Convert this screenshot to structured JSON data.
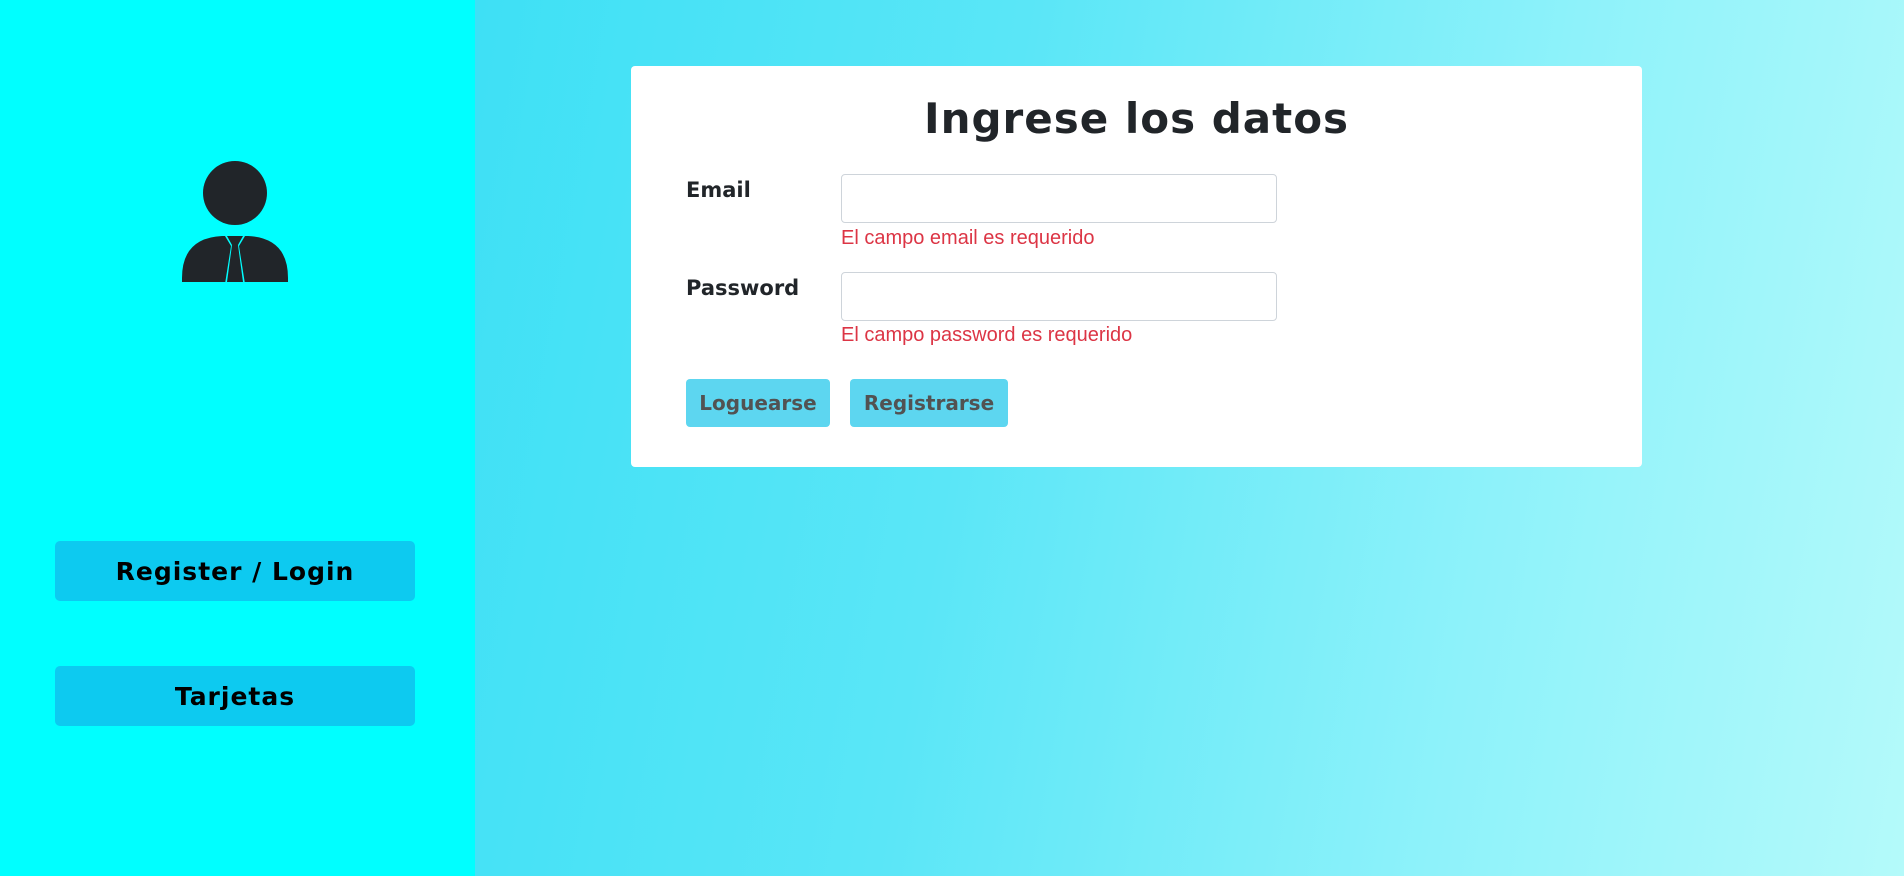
{
  "sidebar": {
    "avatar_icon": "user-tie-icon",
    "background": "#00ffff",
    "buttons": [
      {
        "label": "Register / Login"
      },
      {
        "label": "Tarjetas"
      }
    ],
    "button_color": "#0dcaf0"
  },
  "form": {
    "title": "Ingrese los datos",
    "email": {
      "label": "Email",
      "value": "",
      "error": "El campo email es requerido"
    },
    "password": {
      "label": "Password",
      "value": "",
      "error": "El campo password es requerido"
    },
    "login_label": "Loguearse",
    "register_label": "Registrarse",
    "error_color": "#dc3545",
    "button_color": "#5dd6f0"
  }
}
